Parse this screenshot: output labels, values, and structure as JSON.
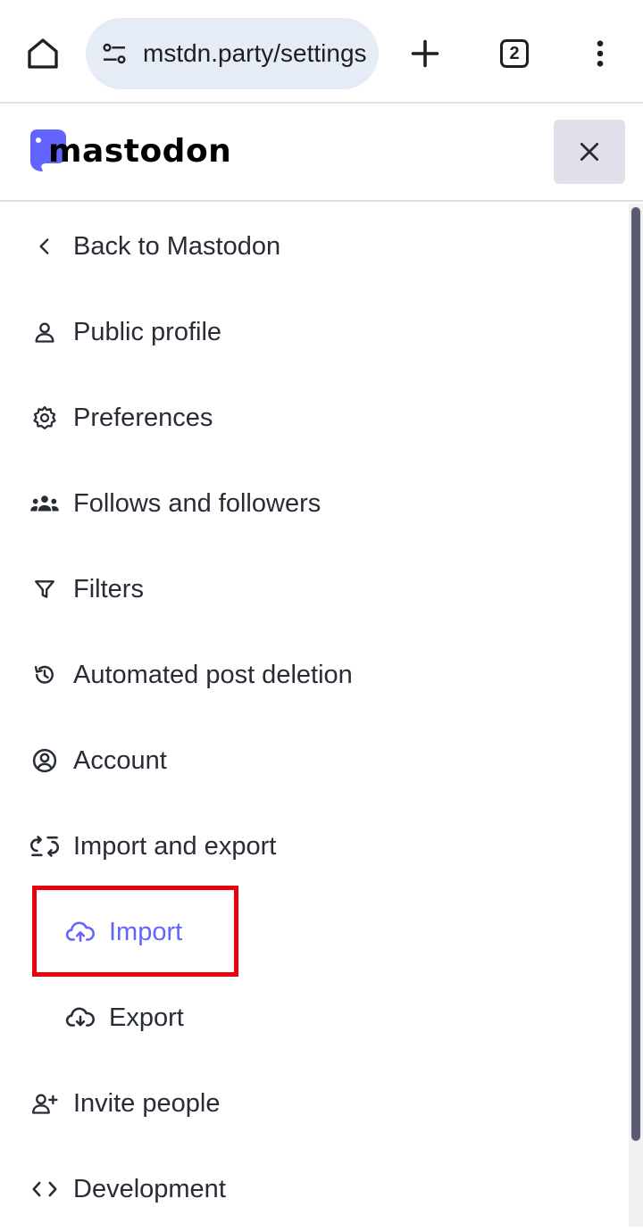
{
  "browser": {
    "url": "mstdn.party/settings/import",
    "tab_count": "2",
    "icons": {
      "home": "home-icon",
      "site_settings": "tune-icon",
      "new_tab": "plus-icon",
      "menu": "more-vert-icon"
    }
  },
  "header": {
    "logo_text": "mastodon",
    "brand_color": "#6364ff",
    "close_icon": "close-icon"
  },
  "nav": {
    "accent_color": "#6364ff",
    "items": [
      {
        "label": "Back to Mastodon",
        "icon": "chevron-left-icon"
      },
      {
        "label": "Public profile",
        "icon": "person-icon"
      },
      {
        "label": "Preferences",
        "icon": "gear-icon"
      },
      {
        "label": "Follows and followers",
        "icon": "group-icon"
      },
      {
        "label": "Filters",
        "icon": "filter-icon"
      },
      {
        "label": "Automated post deletion",
        "icon": "history-icon"
      },
      {
        "label": "Account",
        "icon": "account-circle-icon"
      },
      {
        "label": "Import and export",
        "icon": "import-export-icon"
      },
      {
        "label": "Import",
        "icon": "cloud-upload-icon",
        "sub": true,
        "active": true
      },
      {
        "label": "Export",
        "icon": "cloud-download-icon",
        "sub": true
      },
      {
        "label": "Invite people",
        "icon": "person-add-icon"
      },
      {
        "label": "Development",
        "icon": "code-icon"
      }
    ]
  }
}
